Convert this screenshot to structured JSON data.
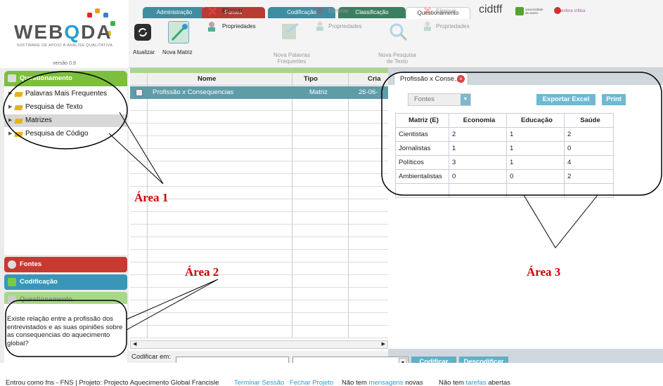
{
  "logo": {
    "word_pre": "WEB",
    "word_q": "Q",
    "word_post": "DA",
    "tagline": "SOFTWARE DE APOIO À ANÁLISE QUALITATIVA",
    "version": "versão 0.9"
  },
  "tabs": [
    {
      "label": "Administração",
      "color": "#3f8da0"
    },
    {
      "label": "Fontes",
      "color": "#b83a32"
    },
    {
      "label": "Codificação",
      "color": "#3f8da0"
    },
    {
      "label": "Classificação",
      "color": "#3b7f60"
    },
    {
      "label": "Questionamento",
      "color": "#ffffff"
    }
  ],
  "header_right": {
    "brand": "cidtff",
    "partner1": "universidade de aveiro",
    "partner2": "esfera crítica"
  },
  "toolbar": {
    "refresh": "Atualizar",
    "new_matrix": "Nova Matriz",
    "delete1": "Eliminar",
    "props1": "Propriedades",
    "new_words": "Nova Palavras Frequentes",
    "delete2": "Eliminar",
    "props2": "Propriedades",
    "new_search": "Nova Pesquisa de Texto",
    "delete3": "Eliminar",
    "props3": "Propriedades"
  },
  "left": {
    "section_title": "Questionamento",
    "tree": [
      "Palavras Mais Frequentes",
      "Pesquisa de Texto",
      "Matrizes",
      "Pesquisa de Código"
    ],
    "panel_fontes": "Fontes",
    "panel_codificacao": "Codificação",
    "panel_questionamento": "Questionamento",
    "note": "Existe relação entre a profissão dos entrevistados e as suas opiniões sobre as consequencias do aquecimento global?"
  },
  "grid": {
    "headers": [
      "Nome",
      "Tipo",
      "Cria"
    ],
    "rows": [
      {
        "name": "Profissão x Consequencias",
        "type": "Matriz",
        "created": "26-06-"
      }
    ],
    "codify_label": "Codificar em:",
    "btn_codify": "Codificar",
    "btn_uncodify": "Descodificar"
  },
  "right": {
    "tab_title": "Profissão x Conse...",
    "source_select": "Fontes",
    "btn_export": "Exportar Excel",
    "btn_print": "Print",
    "matrix": {
      "headers": [
        "Matriz (E)",
        "Economia",
        "Educação",
        "Saúde"
      ],
      "rows": [
        [
          "Cientistas",
          "2",
          "1",
          "2"
        ],
        [
          "Jornalistas",
          "1",
          "1",
          "0"
        ],
        [
          "Políticos",
          "3",
          "1",
          "4"
        ],
        [
          "Ambientalistas",
          "0",
          "0",
          "2"
        ]
      ]
    }
  },
  "annotations": {
    "area1": "Área 1",
    "area2": "Área 2",
    "area3": "Área 3"
  },
  "status": {
    "login": "Entrou como fns - FNS | Projeto: Projecto Aquecimento Global Francisle",
    "logout": "Terminar Sessão",
    "close_project": "Fechar Projeto",
    "messages_pre": "Não tem",
    "messages_link": "mensagens",
    "messages_post": "novas",
    "tasks_pre": "Não tem",
    "tasks_link": "tarefas",
    "tasks_post": "abertas"
  }
}
